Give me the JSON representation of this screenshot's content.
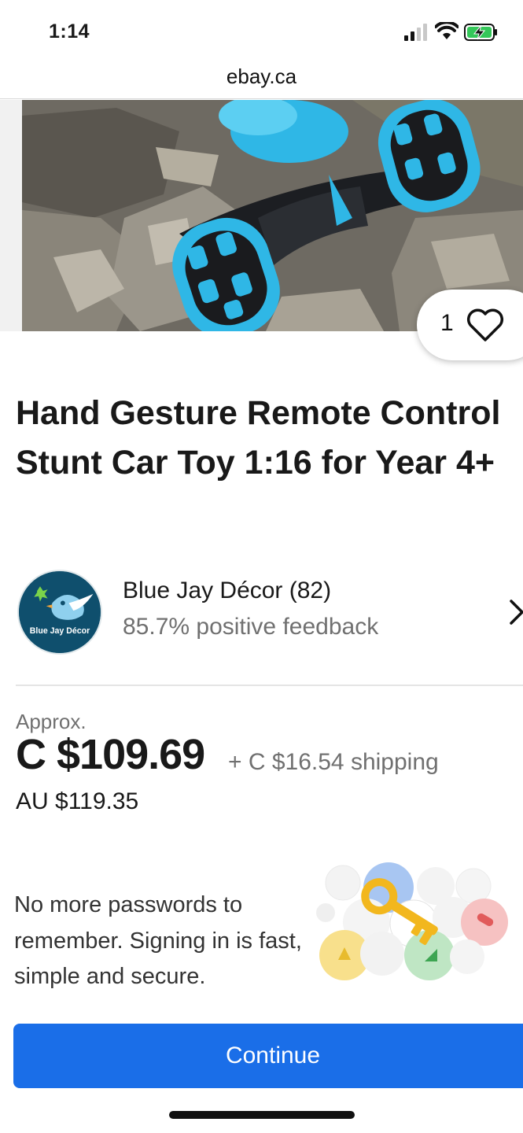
{
  "status_bar": {
    "time": "1:14"
  },
  "browser": {
    "url": "ebay.ca"
  },
  "listing": {
    "watch_count": "1",
    "title": "Hand Gesture Remote Control Stunt Car Toy 1:16 for Year 4+"
  },
  "seller": {
    "name": "Blue Jay Décor (82)",
    "feedback": "85.7% positive feedback",
    "logo_text": "Blue Jay Décor"
  },
  "pricing": {
    "approx_label": "Approx.",
    "price": "C $109.69",
    "shipping": "+ C $16.54 shipping",
    "alt_price": "AU $119.35"
  },
  "sign_in_sheet": {
    "message": "No more passwords to remember. Signing in is fast, simple and secure.",
    "continue_label": "Continue"
  },
  "colors": {
    "accent": "#1a6ee8",
    "car": "#2fb7e6"
  }
}
